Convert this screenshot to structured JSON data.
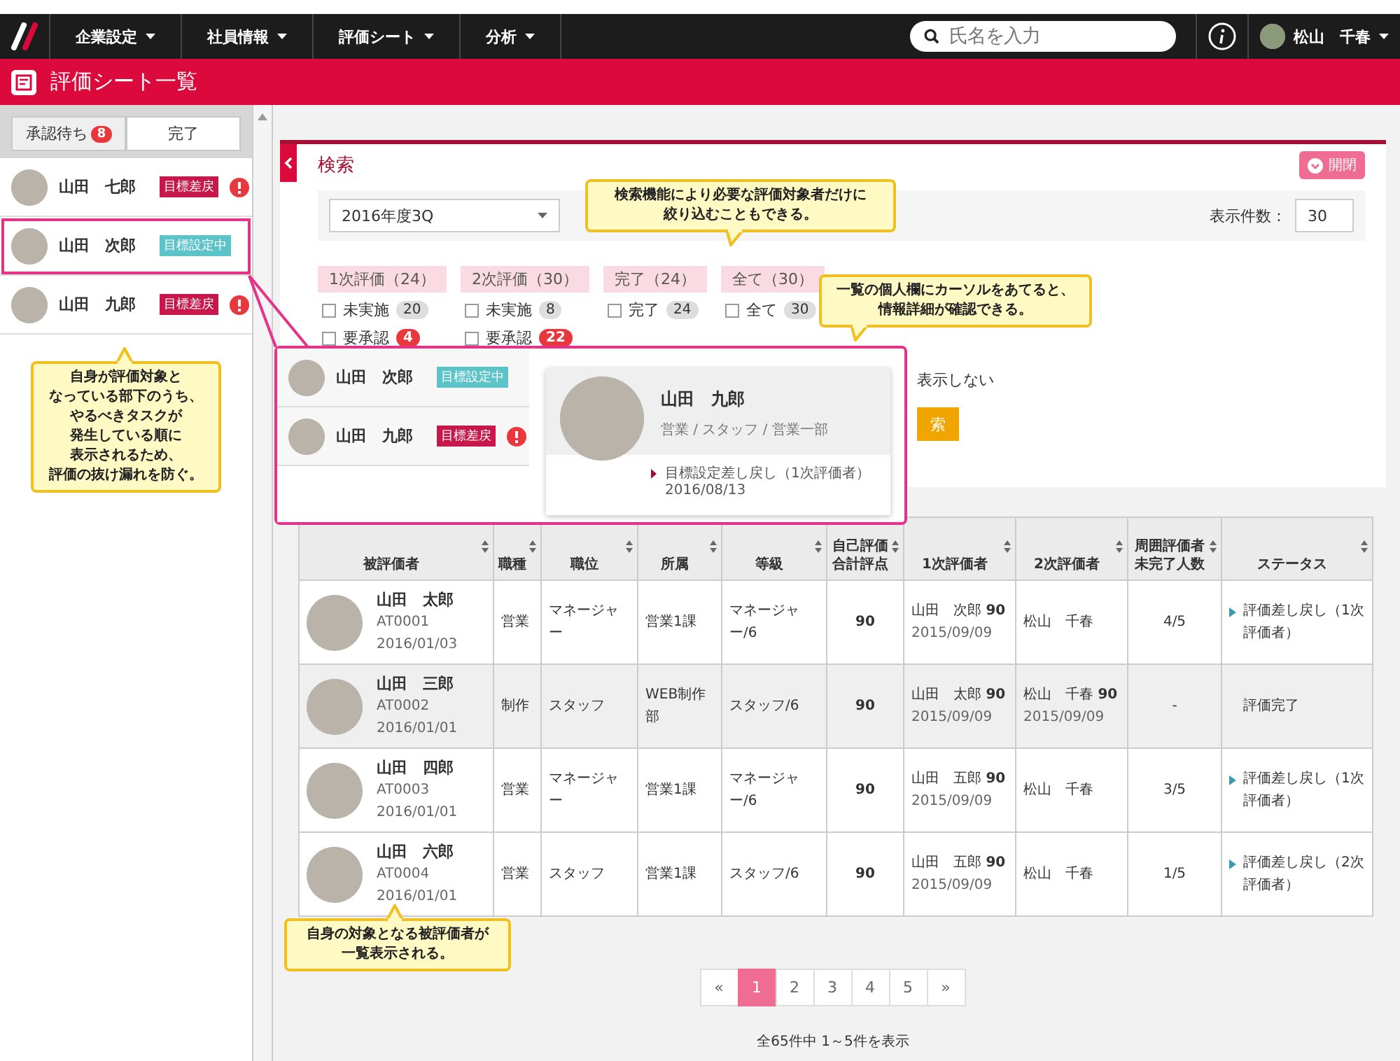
{
  "nav": {
    "menus": [
      {
        "label": "企業設定"
      },
      {
        "label": "社員情報"
      },
      {
        "label": "評価シート"
      },
      {
        "label": "分析"
      }
    ],
    "search": {
      "placeholder": "氏名を入力"
    },
    "user": {
      "name": "松山　千春"
    }
  },
  "title_bar": {
    "title": "評価シート一覧"
  },
  "sidebar": {
    "tabs": [
      {
        "label": "承認待ち",
        "badge": "8",
        "selected": true
      },
      {
        "label": "完了",
        "selected": false
      }
    ],
    "items": [
      {
        "name": "山田　七郎",
        "tag": "目標差戻",
        "color": "#c8174a",
        "alert": true,
        "highlighted": false
      },
      {
        "name": "山田　次郎",
        "tag": "目標設定中",
        "color": "#5cc4c9",
        "alert": false,
        "highlighted": true
      },
      {
        "name": "山田　九郎",
        "tag": "目標差戻",
        "color": "#c8174a",
        "alert": true,
        "highlighted": false
      }
    ]
  },
  "search_panel": {
    "title": "検索",
    "toggle_label": "開閉",
    "period": {
      "value": "2016年度3Q"
    },
    "page_size": {
      "label": "表示件数：",
      "value": "30"
    },
    "filter_groups": [
      {
        "heading": "1次評価（24）",
        "options": [
          {
            "label": "未実施",
            "count": "20",
            "alert": false,
            "checked": false
          },
          {
            "label": "要承認",
            "count": "4",
            "alert": true,
            "checked": false
          }
        ]
      },
      {
        "heading": "2次評価（30）",
        "options": [
          {
            "label": "未実施",
            "count": "8",
            "alert": false,
            "checked": false
          },
          {
            "label": "要承認",
            "count": "22",
            "alert": true,
            "checked": false
          }
        ]
      },
      {
        "heading": "完了（24）",
        "options": [
          {
            "label": "完了",
            "count": "24",
            "alert": false,
            "checked": false
          }
        ]
      },
      {
        "heading": "全て（30）",
        "options": [
          {
            "label": "全て",
            "count": "30",
            "alert": false,
            "checked": false
          }
        ]
      }
    ],
    "hidden_option": "表示しない",
    "search_button": "索"
  },
  "table": {
    "columns": [
      {
        "label": "被評価者"
      },
      {
        "label": "職種"
      },
      {
        "label": "職位"
      },
      {
        "label": "所属"
      },
      {
        "label": "等級"
      },
      {
        "label": "自己評価合計評点"
      },
      {
        "label": "1次評価者"
      },
      {
        "label": "2次評価者"
      },
      {
        "label": "周囲評価者未完了人数"
      },
      {
        "label": "ステータス"
      }
    ],
    "rows": [
      {
        "highlighted": false,
        "name": "山田　太郎",
        "id": "AT0001",
        "date": "2016/01/03",
        "job": "営業",
        "position": "マネージャー",
        "department": "営業1課",
        "grade": "マネージャー/6",
        "self_score": "90",
        "first_evaluator": {
          "name": "山田　次郎",
          "score": "90",
          "date": "2015/09/09"
        },
        "second_evaluator": {
          "name": "松山　千春"
        },
        "pending": "4/5",
        "status": {
          "text": "評価差し戻し（1次評価者）",
          "arrow": true
        }
      },
      {
        "highlighted": true,
        "name": "山田　三郎",
        "id": "AT0002",
        "date": "2016/01/01",
        "job": "制作",
        "position": "スタッフ",
        "department": "WEB制作部",
        "grade": "スタッフ/6",
        "self_score": "90",
        "first_evaluator": {
          "name": "山田　太郎",
          "score": "90",
          "date": "2015/09/09"
        },
        "second_evaluator": {
          "name": "松山　千春",
          "score": "90",
          "date": "2015/09/09"
        },
        "pending": "-",
        "status": {
          "text": "評価完了",
          "arrow": false
        }
      },
      {
        "highlighted": false,
        "name": "山田　四郎",
        "id": "AT0003",
        "date": "2016/01/01",
        "job": "営業",
        "position": "マネージャー",
        "department": "営業1課",
        "grade": "マネージャー/6",
        "self_score": "90",
        "first_evaluator": {
          "name": "山田　五郎",
          "score": "90",
          "date": "2015/09/09"
        },
        "second_evaluator": {
          "name": "松山　千春"
        },
        "pending": "3/5",
        "status": {
          "text": "評価差し戻し（1次評価者）",
          "arrow": true
        }
      },
      {
        "highlighted": false,
        "name": "山田　六郎",
        "id": "AT0004",
        "date": "2016/01/01",
        "job": "営業",
        "position": "スタッフ",
        "department": "営業1課",
        "grade": "スタッフ/6",
        "self_score": "90",
        "first_evaluator": {
          "name": "山田　五郎",
          "score": "90",
          "date": "2015/09/09"
        },
        "second_evaluator": {
          "name": "松山　千春"
        },
        "pending": "1/5",
        "status": {
          "text": "評価差し戻し（2次評価者）",
          "arrow": true
        }
      }
    ]
  },
  "pagination": {
    "items": [
      {
        "label": "«",
        "selected": false
      },
      {
        "label": "1",
        "selected": true
      },
      {
        "label": "2",
        "selected": false
      },
      {
        "label": "3",
        "selected": false
      },
      {
        "label": "4",
        "selected": false
      },
      {
        "label": "5",
        "selected": false
      },
      {
        "label": "»",
        "selected": false
      }
    ]
  },
  "summary": "全65件中 1～5件を表示",
  "zoom_popup": {
    "items": [
      {
        "name": "山田　次郎",
        "tag": "目標設定中",
        "color": "#5cc4c9",
        "alert": false
      },
      {
        "name": "山田　九郎",
        "tag": "目標差戻",
        "color": "#c8174a",
        "alert": true
      }
    ],
    "card": {
      "name": "山田　九郎",
      "meta": "営業 / スタッフ / 営業一部",
      "task": "目標設定差し戻し（1次評価者）",
      "date": "2016/08/13"
    }
  },
  "callouts": [
    {
      "kind": "search",
      "lines": [
        "検索機能により必要な評価対象者だけに",
        "絞り込むこともできる。"
      ]
    },
    {
      "kind": "hover",
      "lines": [
        "一覧の個人欄にカーソルをあてると、",
        "情報詳細が確認できる。"
      ]
    },
    {
      "kind": "sidebar",
      "lines": [
        "自身が評価対象と",
        "なっている部下のうち、",
        "やるべきタスクが",
        "発生している順に",
        "表示されるため、",
        "評価の抜け漏れを防ぐ。"
      ]
    },
    {
      "kind": "table",
      "lines": [
        "自身の対象となる被評価者が",
        "一覧表示される。"
      ]
    }
  ]
}
